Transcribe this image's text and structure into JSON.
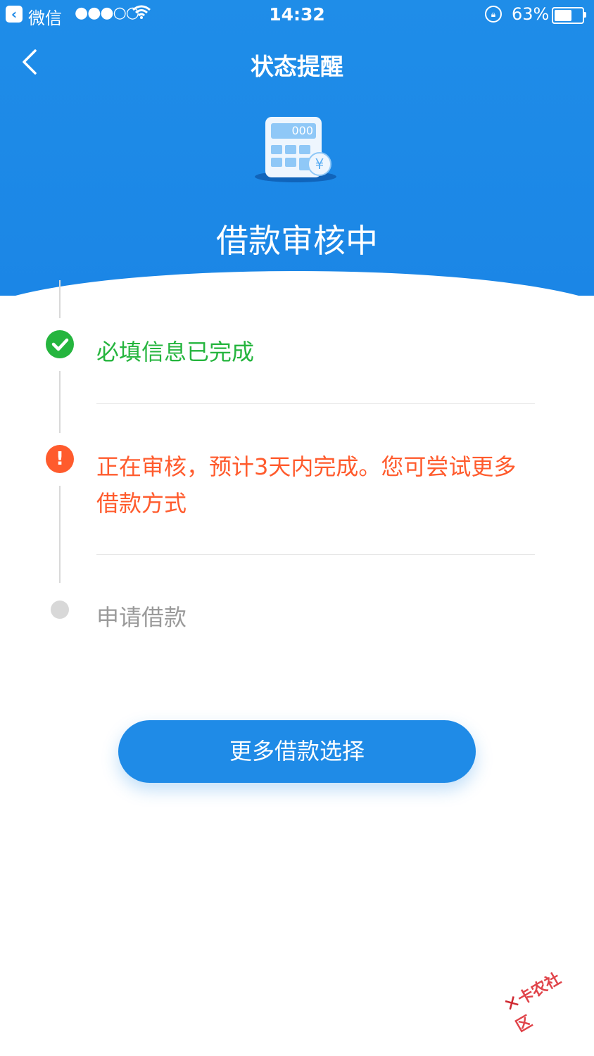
{
  "status_bar": {
    "back_app": "微信",
    "signal": "●●●○○",
    "time": "14:32",
    "battery_percent_text": "63%",
    "battery_level": 0.63
  },
  "nav": {
    "title": "状态提醒"
  },
  "header": {
    "calc_display": "000",
    "currency_glyph": "¥",
    "status_title": "借款审核中"
  },
  "steps": [
    {
      "text": "必填信息已完成",
      "state": "done",
      "color": "#25b53e"
    },
    {
      "text": "正在审核，预计3天内完成。您可尝试更多借款方式",
      "state": "warning",
      "color": "#ff5b2d"
    },
    {
      "text": "申请借款",
      "state": "pending",
      "color": "#9a9a9a"
    }
  ],
  "cta": {
    "label": "更多借款选择"
  },
  "watermark": {
    "text": "卡农社区"
  },
  "colors": {
    "header_blue": "#1c88e6",
    "button_blue": "#1f8be7",
    "success_green": "#25b53e",
    "warning_orange": "#ff5b2d",
    "pending_gray": "#d8d8d8"
  },
  "icons": {
    "back": "chevron-left-icon",
    "done": "check-circle-icon",
    "warning": "exclamation-circle-icon",
    "pending": "gray-dot-icon",
    "header": "calculator-yen-icon"
  }
}
